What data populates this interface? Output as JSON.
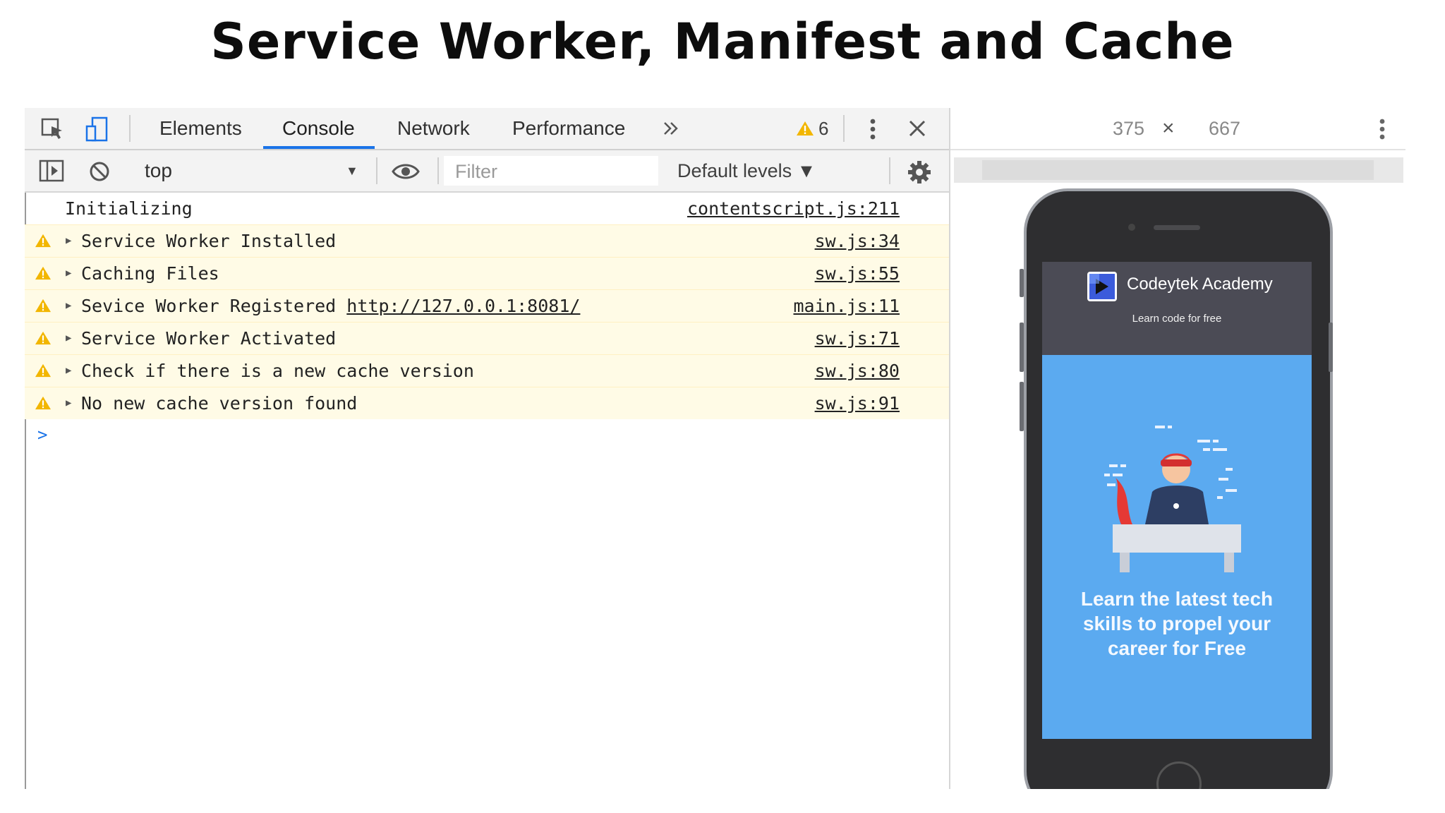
{
  "slide": {
    "title": "Service Worker, Manifest and Cache"
  },
  "devtools": {
    "tabs": [
      {
        "label": "Elements"
      },
      {
        "label": "Console"
      },
      {
        "label": "Network"
      },
      {
        "label": "Performance"
      }
    ],
    "active_tab": "Console",
    "warning_count": "6",
    "context": "top",
    "filter": {
      "placeholder": "Filter",
      "value": ""
    },
    "levels": "Default levels ▼",
    "messages": [
      {
        "level": "info",
        "text": "Initializing",
        "source": "contentscript.js:211"
      },
      {
        "level": "warning",
        "text": "Service Worker Installed",
        "source": "sw.js:34"
      },
      {
        "level": "warning",
        "text": "Caching Files",
        "source": "sw.js:55"
      },
      {
        "level": "warning",
        "text": "Sevice Worker Registered ",
        "link": "http://127.0.0.1:8081/",
        "source": "main.js:11"
      },
      {
        "level": "warning",
        "text": "Service Worker Activated",
        "source": "sw.js:71"
      },
      {
        "level": "warning",
        "text": "Check if there is a new cache version",
        "source": "sw.js:80"
      },
      {
        "level": "warning",
        "text": "No new cache version found",
        "source": "sw.js:91"
      }
    ],
    "prompt": ">"
  },
  "device": {
    "width": "375",
    "times": "×",
    "height": "667",
    "app": {
      "name": "Codeytek Academy",
      "tagline": "Learn code for free",
      "hero_lines": [
        "Learn the latest tech",
        "skills to propel your",
        "career for Free"
      ]
    }
  },
  "colors": {
    "accent": "#1a73e8",
    "warning_bg": "#fffbe6",
    "warning_icon": "#f2b600",
    "app_header": "#4b4b55",
    "app_hero": "#5baaf0"
  }
}
